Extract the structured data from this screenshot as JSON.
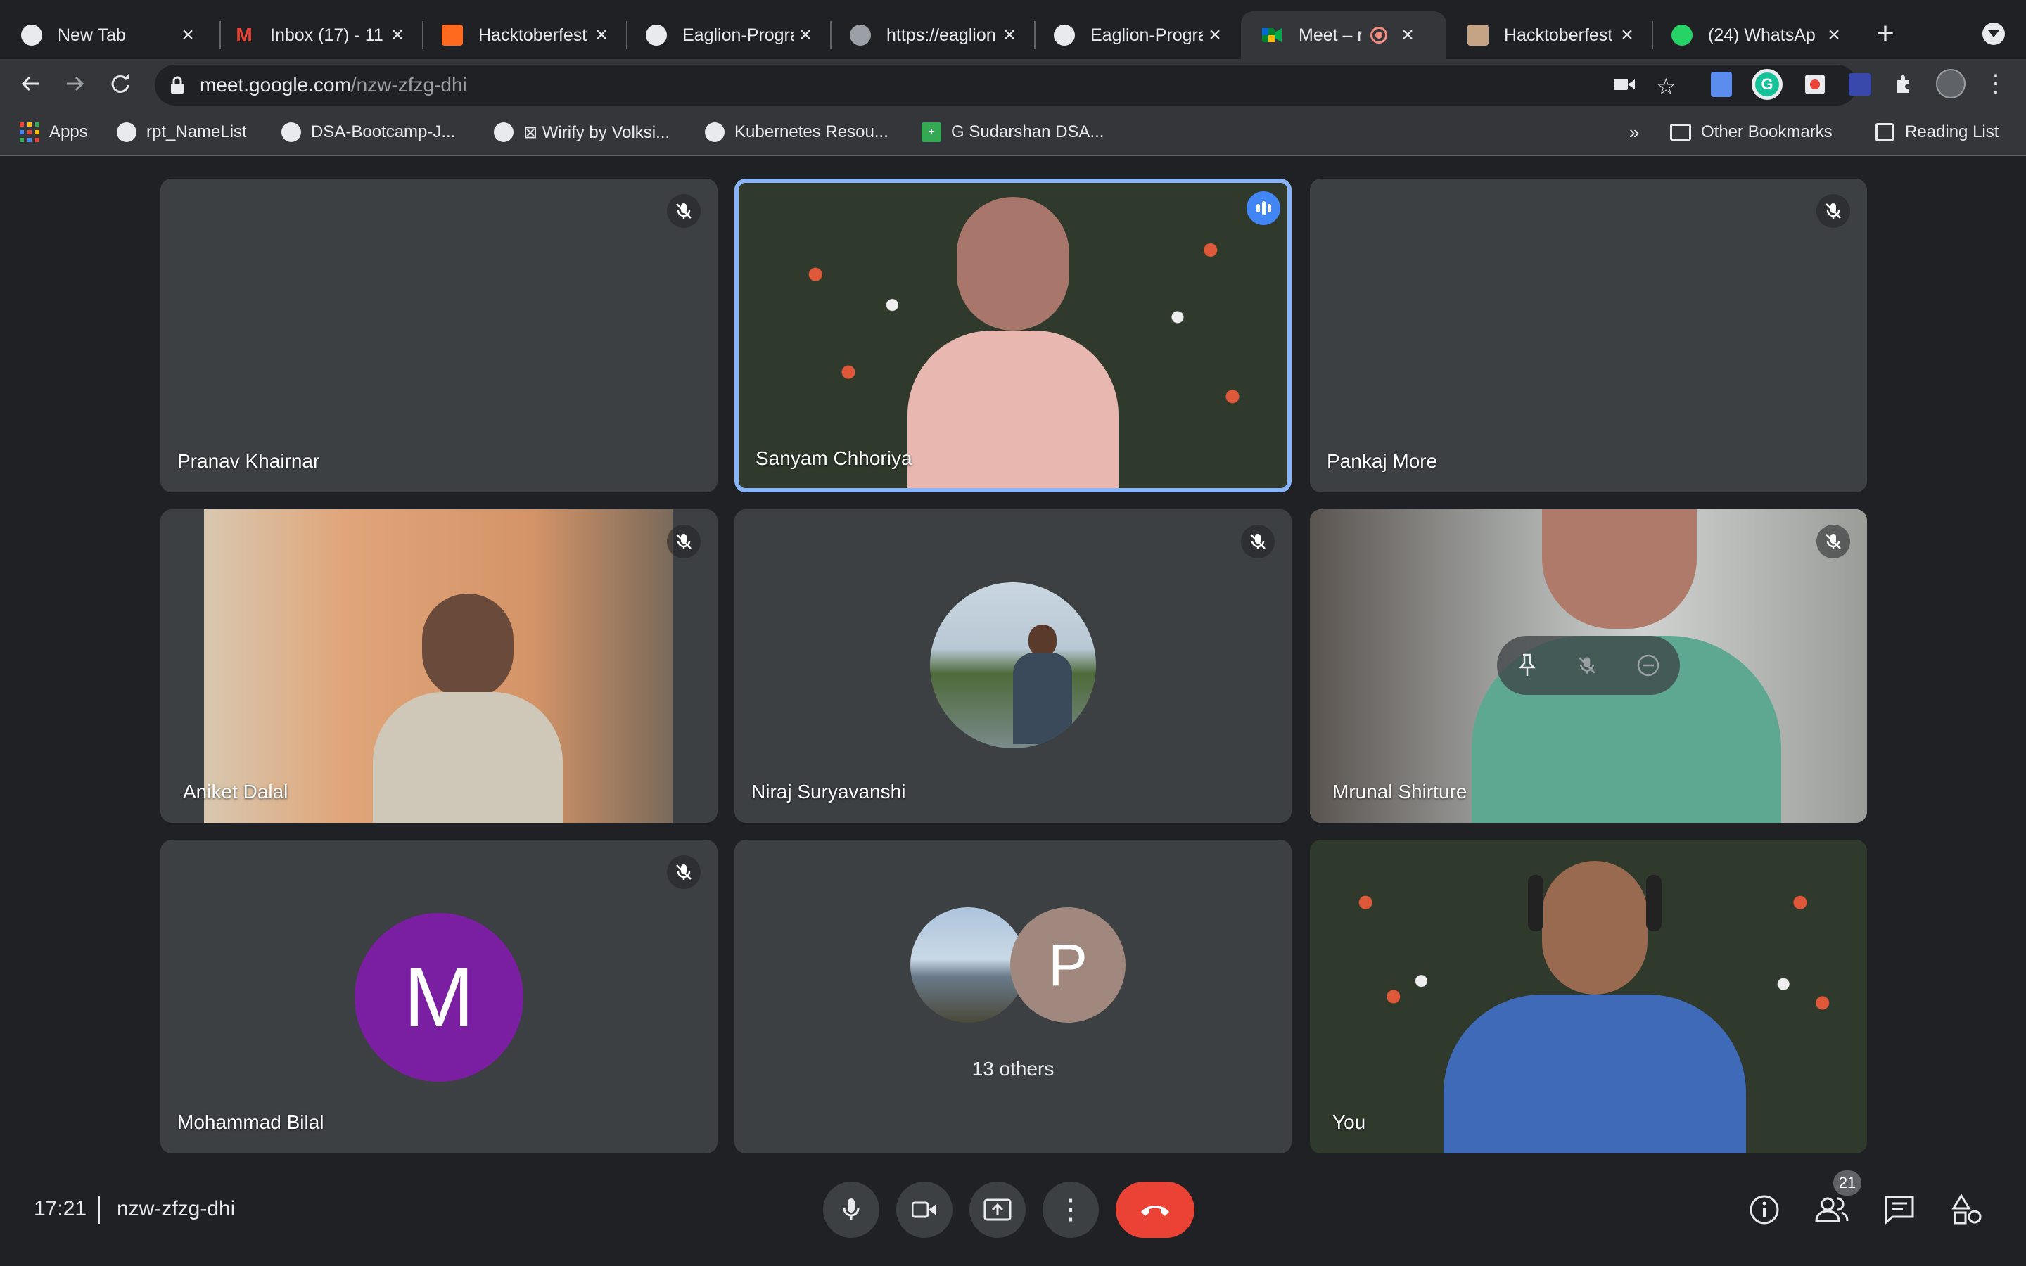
{
  "tabs": [
    {
      "title": "New Tab",
      "icon": "chrome-icon",
      "color": "#e8eaed"
    },
    {
      "title": "Inbox (17) - 11",
      "icon": "gmail-icon",
      "color": "#ea4335"
    },
    {
      "title": "Hacktoberfest",
      "icon": "hacktoberfest-icon",
      "color": "#ff8ae2"
    },
    {
      "title": "Eaglion-Progra",
      "icon": "github-icon",
      "color": "#e8eaed"
    },
    {
      "title": "https://eaglion",
      "icon": "globe-icon",
      "color": "#e8eaed"
    },
    {
      "title": "Eaglion-Progra",
      "icon": "github-icon",
      "color": "#e8eaed"
    },
    {
      "title": "Meet – nz",
      "icon": "meet-icon",
      "color": "#00832d"
    },
    {
      "title": "Hacktoberfest",
      "icon": "hacktoberfest-icon",
      "color": "#c4a484"
    },
    {
      "title": "(24) WhatsAp",
      "icon": "whatsapp-icon",
      "color": "#25d366"
    }
  ],
  "url": {
    "domain": "meet.google.com",
    "path": "/nzw-zfzg-dhi"
  },
  "bookmarks": [
    {
      "label": "Apps",
      "icon": "apps-grid-icon"
    },
    {
      "label": "rpt_NameList",
      "icon": "globe-icon"
    },
    {
      "label": "DSA-Bootcamp-J...",
      "icon": "github-icon"
    },
    {
      "label": "⊠ Wirify by Volksi...",
      "icon": "globe-icon"
    },
    {
      "label": "Kubernetes Resou...",
      "icon": "github-icon"
    },
    {
      "label": "G Sudarshan DSA...",
      "icon": "sheets-icon"
    }
  ],
  "bookmark_extras": {
    "more": "»",
    "other": "Other Bookmarks",
    "reading": "Reading List"
  },
  "participants": [
    {
      "name": "Pranav Khairnar",
      "muted": true,
      "video": false
    },
    {
      "name": "Sanyam Chhoriya",
      "muted": false,
      "speaking": true,
      "video": true
    },
    {
      "name": "Pankaj More",
      "muted": true,
      "video": false
    },
    {
      "name": "Aniket Dalal",
      "muted": true,
      "video": true
    },
    {
      "name": "Niraj Suryavanshi",
      "muted": true,
      "video": false,
      "avatar": "photo"
    },
    {
      "name": "Mrunal Shirture",
      "muted": true,
      "video": true
    },
    {
      "name": "Mohammad Bilal",
      "muted": true,
      "video": false,
      "initial": "M",
      "avatar_color": "#7b1fa2"
    },
    {
      "name": "13 others",
      "initial": "P",
      "avatar_color": "#a1887f"
    },
    {
      "name": "You",
      "video": true
    }
  ],
  "meeting": {
    "time": "17:21",
    "code": "nzw-zfzg-dhi"
  },
  "people_count": "21",
  "colors": {
    "accent_blue": "#8ab4f8",
    "speaking_blue": "#4285f4",
    "end_call_red": "#ea4335"
  }
}
